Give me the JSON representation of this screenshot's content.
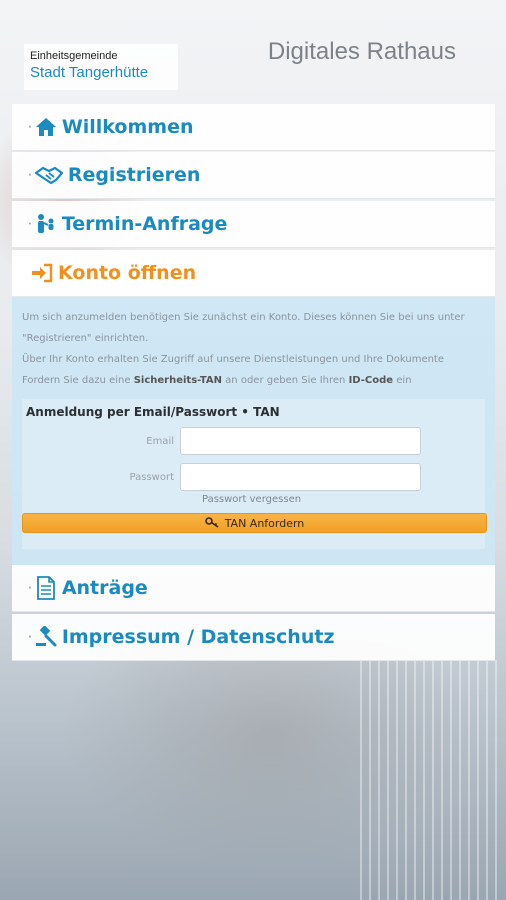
{
  "header": {
    "logo_small": "Einheitsgemeinde",
    "logo_big": "Stadt Tangerhütte",
    "app_title": "Digitales Rathaus"
  },
  "nav": {
    "items": [
      {
        "label": "Willkommen",
        "icon": "home-icon"
      },
      {
        "label": "Registrieren",
        "icon": "handshake-icon"
      },
      {
        "label": "Termin-Anfrage",
        "icon": "people-icon"
      },
      {
        "label": "Konto öffnen",
        "icon": "sign-in-icon",
        "active": true
      },
      {
        "label": "Anträge",
        "icon": "document-icon"
      },
      {
        "label": "Impressum / Datenschutz",
        "icon": "gavel-icon"
      }
    ]
  },
  "konto": {
    "intro_line1": "Um sich anzumelden benötigen Sie zunächst ein Konto. Dieses können Sie bei uns unter",
    "intro_line2": "\"Registrieren\" einrichten.",
    "intro_line3": "Über Ihr Konto erhalten Sie Zugriff auf unsere Dienstleistungen und Ihre Dokumente",
    "intro_line4_a": "Fordern Sie dazu eine ",
    "intro_line4_b": "Sicherheits-TAN",
    "intro_line4_c": " an oder geben Sie Ihren ",
    "intro_line4_d": "ID-Code",
    "intro_line4_e": " ein",
    "form_title": "Anmeldung per Email/Passwort • TAN",
    "email_label": "Email",
    "email_value": "",
    "password_label": "Passwort",
    "password_value": "",
    "forgot_label": "Passwort vergessen",
    "tan_button": "TAN Anfordern"
  },
  "colors": {
    "accent": "#1a8bbf",
    "active": "#f0901e",
    "button": "#f2a028"
  }
}
